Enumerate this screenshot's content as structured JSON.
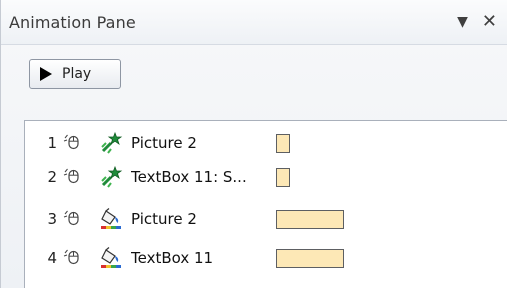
{
  "pane": {
    "title": "Animation Pane",
    "menu_icon": "dropdown-triangle-icon",
    "close_icon": "close-icon"
  },
  "toolbar": {
    "play_label": "Play",
    "play_icon": "play-triangle-icon"
  },
  "animations": [
    {
      "index": "1",
      "name": "Picture 2",
      "trigger_icon": "mouse-click-icon",
      "effect_icon": "star-entrance-effect-icon",
      "timing_size": "small"
    },
    {
      "index": "2",
      "name": "TextBox 11: S...",
      "trigger_icon": "mouse-click-icon",
      "effect_icon": "star-entrance-effect-icon",
      "timing_size": "small"
    },
    {
      "index": "3",
      "name": "Picture 2",
      "trigger_icon": "mouse-click-icon",
      "effect_icon": "paint-bucket-emphasis-icon",
      "timing_size": "large"
    },
    {
      "index": "4",
      "name": "TextBox 11",
      "trigger_icon": "mouse-click-icon",
      "effect_icon": "paint-bucket-emphasis-icon",
      "timing_size": "large"
    }
  ],
  "colors": {
    "timing_fill": "#fde8b6",
    "timing_border": "#5d5f62",
    "star_green": "#1f8b3a"
  }
}
